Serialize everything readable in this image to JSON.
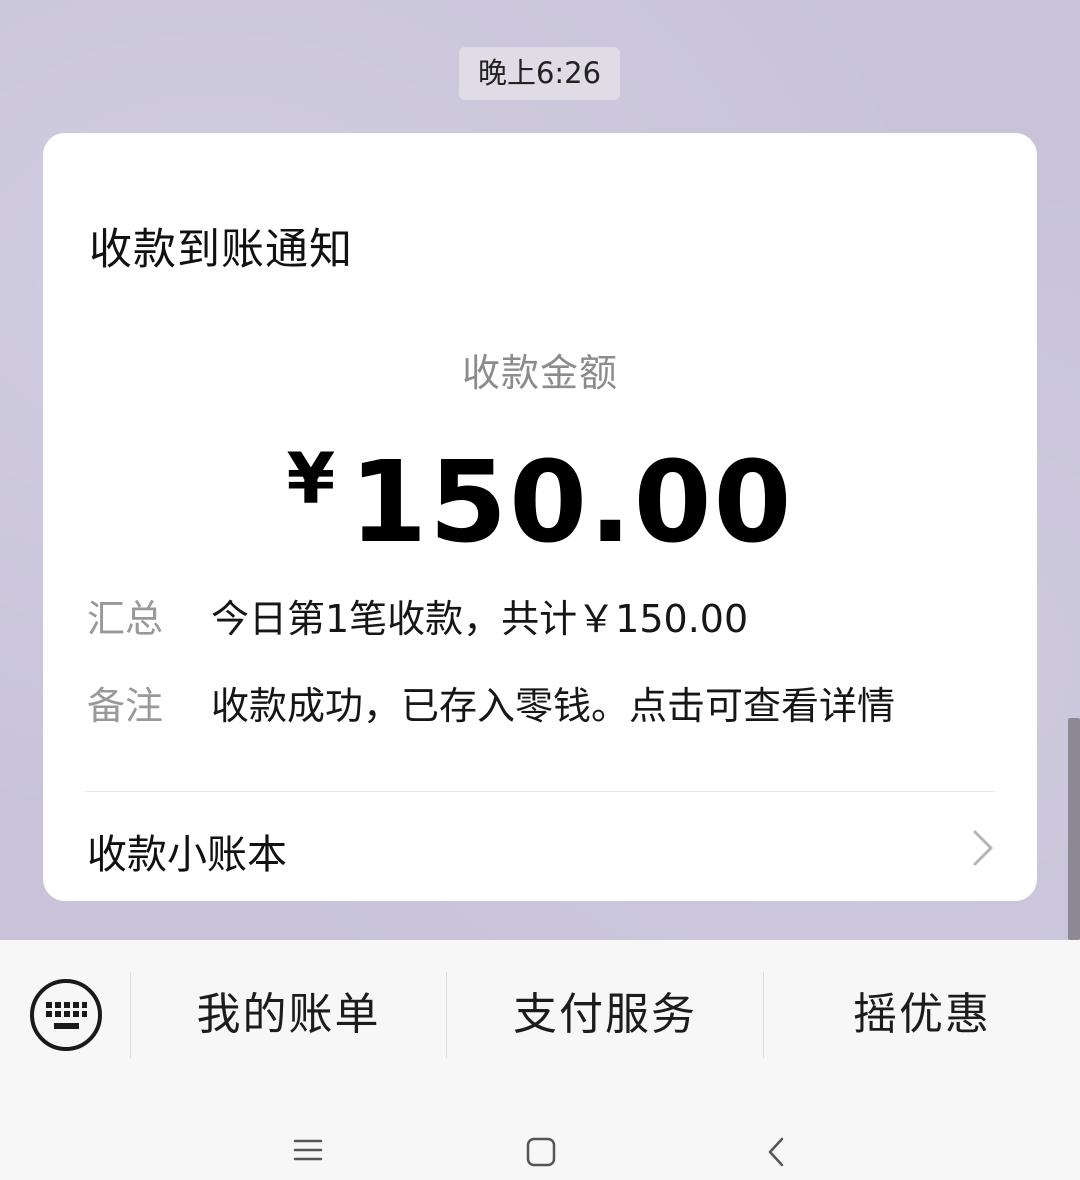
{
  "chat": {
    "timestamp": "晚上6:26"
  },
  "card": {
    "title": "收款到账通知",
    "amount_label": "收款金额",
    "currency_symbol": "¥",
    "amount": "150.00",
    "summary_label": "汇总",
    "summary_value": "今日第1笔收款，共计￥150.00",
    "note_label": "备注",
    "note_value": "收款成功，已存入零钱。点击可查看详情",
    "ledger_label": "收款小账本",
    "ledger_icon": "chevron-right-icon"
  },
  "bottom_menu": {
    "keyboard_icon": "keyboard-icon",
    "items": [
      {
        "label": "我的账单"
      },
      {
        "label": "支付服务"
      },
      {
        "label": "摇优惠"
      }
    ]
  },
  "nav": {
    "menu_icon": "menu-icon",
    "home_icon": "home-icon",
    "back_icon": "back-icon"
  },
  "colors": {
    "chat_background": "#c8c3d9",
    "card_background": "#ffffff",
    "muted_text": "#999999",
    "bar_background": "#f7f7f7"
  }
}
